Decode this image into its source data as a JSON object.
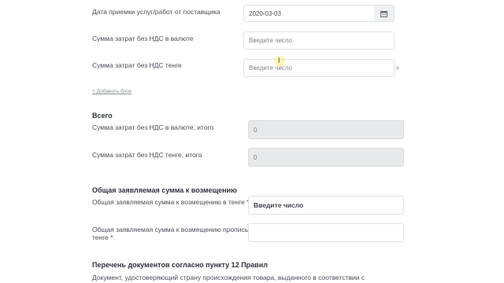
{
  "form": {
    "date_label": "Дата приемки услуг/работ от поставщика",
    "date_value": "2020-03-03",
    "sum_currency_label": "Сумма затрат без НДС в валюте",
    "sum_currency_placeholder": "Введите число",
    "sum_tenge_label": "Сумма затрат без НДС тенге",
    "sum_tenge_placeholder": "Введите число",
    "clear_symbol": "×",
    "add_block_link": "+ Добавить блок"
  },
  "total": {
    "heading": "Всего",
    "currency_total_label": "Сумма затрат без НДС в валюте, итого",
    "currency_total_value": "0",
    "tenge_total_label": "Сумма затрат без НДС тенге, итого",
    "tenge_total_value": "0"
  },
  "refund": {
    "heading": "Общая заявляемая сумма к возмещению",
    "tenge_label": "Общая заявляемая сумма к возмещению в тенге *",
    "tenge_placeholder": "Введите число",
    "words_label_line1": "Общая заявляемая сумма к возмещению прописью в",
    "words_label_line2": "тенге *",
    "words_value": ""
  },
  "documents": {
    "heading": "Перечень документов согласно пункту 12 Правил",
    "text": "Документ, удостоверяющий страну происхождения товара, выданного в соответствии с"
  },
  "cursor_glyph": "I",
  "icons": {
    "calendar": "calendar-icon",
    "clear": "close-icon"
  }
}
